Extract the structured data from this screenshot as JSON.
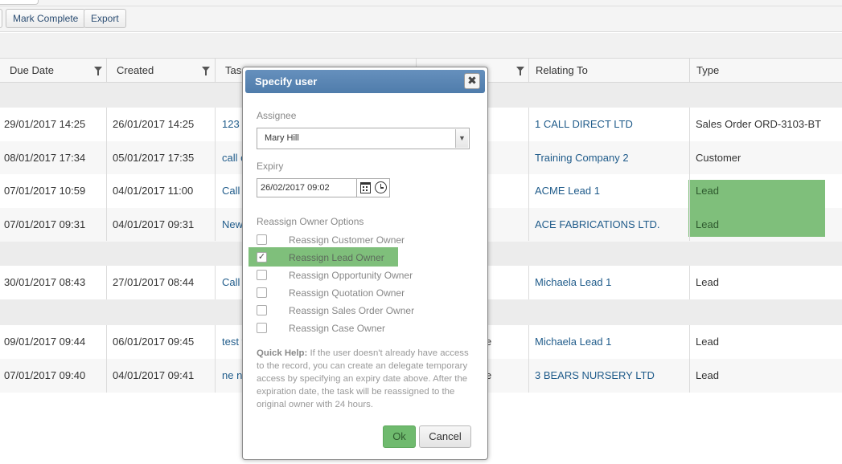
{
  "toolbar": {
    "mark_complete_label": "Mark Complete",
    "export_label": "Export"
  },
  "grid": {
    "columns": [
      {
        "label": "Due Date",
        "filter": true
      },
      {
        "label": "Created",
        "filter": true
      },
      {
        "label": "Tas",
        "filter": false
      },
      {
        "label": "",
        "filter": true
      },
      {
        "label": "Relating To",
        "filter": false
      },
      {
        "label": "Type",
        "filter": false
      }
    ],
    "rows": [
      {
        "due": "29/01/2017 14:25",
        "created": "26/01/2017 14:25",
        "task": "123",
        "relating": "1 CALL DIRECT LTD",
        "type": "Sales Order ORD-3103-BT",
        "type_highlight": false
      },
      {
        "due": "08/01/2017 17:34",
        "created": "05/01/2017 17:35",
        "task": "call c",
        "relating": "Training Company 2",
        "type": "Customer",
        "type_highlight": false
      },
      {
        "due": "07/01/2017 10:59",
        "created": "04/01/2017 11:00",
        "task": "Call t",
        "relating": "ACME Lead 1",
        "type": "Lead",
        "type_highlight": true
      },
      {
        "due": "07/01/2017 09:31",
        "created": "04/01/2017 09:31",
        "task": "New",
        "relating": "ACE FABRICATIONS LTD.",
        "type": "Lead",
        "type_highlight": true
      },
      {
        "due": "30/01/2017 08:43",
        "created": "27/01/2017 08:44",
        "task": "Call l",
        "relating": "Michaela Lead 1",
        "type": "Lead",
        "type_highlight": false
      },
      {
        "due": "09/01/2017 09:44",
        "created": "06/01/2017 09:45",
        "task": "test t",
        "owner_tail": "e",
        "relating": "Michaela Lead 1",
        "type": "Lead",
        "type_highlight": false
      },
      {
        "due": "07/01/2017 09:40",
        "created": "04/01/2017 09:41",
        "task": "ne n",
        "owner_tail": "e",
        "relating": "3 BEARS NURSERY LTD",
        "type": "Lead",
        "type_highlight": false
      }
    ]
  },
  "modal": {
    "title": "Specify user",
    "close_glyph": "✖",
    "assignee_label": "Assignee",
    "assignee_value": "Mary Hill",
    "expiry_label": "Expiry",
    "expiry_value": "26/02/2017 09:02",
    "reassign_label": "Reassign Owner Options",
    "options": [
      {
        "label": "Reassign Customer Owner",
        "checked": false
      },
      {
        "label": "Reassign Lead Owner",
        "checked": true
      },
      {
        "label": "Reassign Opportunity Owner",
        "checked": false
      },
      {
        "label": "Reassign Quotation Owner",
        "checked": false
      },
      {
        "label": "Reassign Sales Order Owner",
        "checked": false
      },
      {
        "label": "Reassign Case Owner",
        "checked": false
      }
    ],
    "help_title": "Quick Help:",
    "help_text": "If the user doesn't already have access to the record, you can create an delegate temporary access by specifying an expiry date above. After the expiration date, the task will be reassigned to the original owner with 24 hours.",
    "ok_label": "Ok",
    "cancel_label": "Cancel"
  },
  "colors": {
    "highlight": "#7fbf7b",
    "title_bar": "#5683b3",
    "link": "#1f5b8a"
  }
}
